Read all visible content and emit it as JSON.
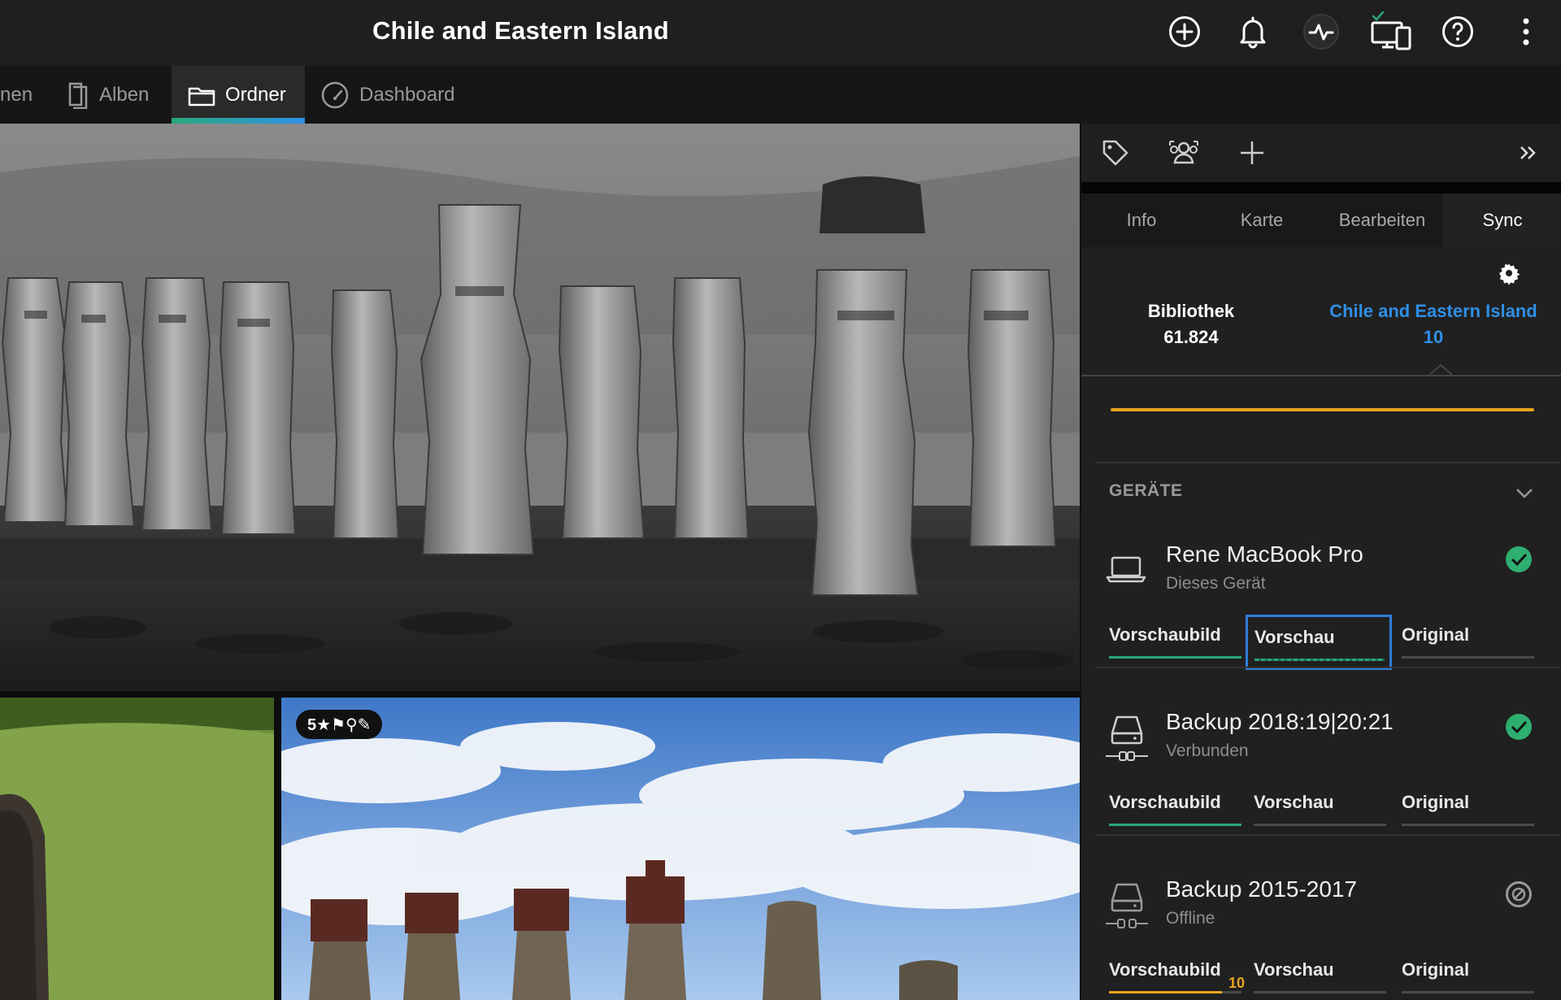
{
  "header": {
    "title": "Chile and Eastern Island",
    "icons": [
      "add-circle-icon",
      "bell-icon",
      "activity-icon",
      "devices-sync-icon",
      "help-icon",
      "more-vertical-icon"
    ]
  },
  "nav": {
    "tabs": [
      {
        "label": "nen",
        "icon": ""
      },
      {
        "label": "Alben",
        "icon": "album-icon"
      },
      {
        "label": "Ordner",
        "icon": "folder-icon",
        "active": true
      },
      {
        "label": "Dashboard",
        "icon": "dashboard-icon"
      }
    ]
  },
  "photo": {
    "badge": "5★⚑⚲✎"
  },
  "panel": {
    "toolbar_icons": [
      "tag-icon",
      "people-icon",
      "plus-icon",
      "expand-icon"
    ],
    "tabs": [
      {
        "label": "Info"
      },
      {
        "label": "Karte"
      },
      {
        "label": "Bearbeiten"
      },
      {
        "label": "Sync",
        "active": true
      }
    ],
    "stats": {
      "library_label": "Bibliothek",
      "library_count": "61.824",
      "folder_label": "Chile and Eastern Island",
      "folder_count": "10"
    },
    "sync_progress": 1.0,
    "colors": {
      "accent_blue": "#2f8fe6",
      "accent_green": "#27a77a",
      "accent_amber": "#e8a51c"
    },
    "devices_heading": "GERÄTE",
    "devices": [
      {
        "name": "Rene MacBook Pro",
        "subtitle": "Dieses Gerät",
        "icon": "laptop-icon",
        "status": "synced",
        "options": [
          "Vorschaubild",
          "Vorschau",
          "Original"
        ],
        "selected": "Vorschaubild",
        "focused": "Vorschau"
      },
      {
        "name": "Backup 2018:19|20:21",
        "subtitle": "Verbunden",
        "icon": "drive-connected-icon",
        "status": "synced",
        "options": [
          "Vorschaubild",
          "Vorschau",
          "Original"
        ],
        "selected": "Vorschaubild"
      },
      {
        "name": "Backup 2015-2017",
        "subtitle": "Offline",
        "icon": "drive-offline-icon",
        "status": "offline",
        "options": [
          "Vorschaubild",
          "Vorschau",
          "Original"
        ],
        "pending_count": "10"
      }
    ]
  }
}
